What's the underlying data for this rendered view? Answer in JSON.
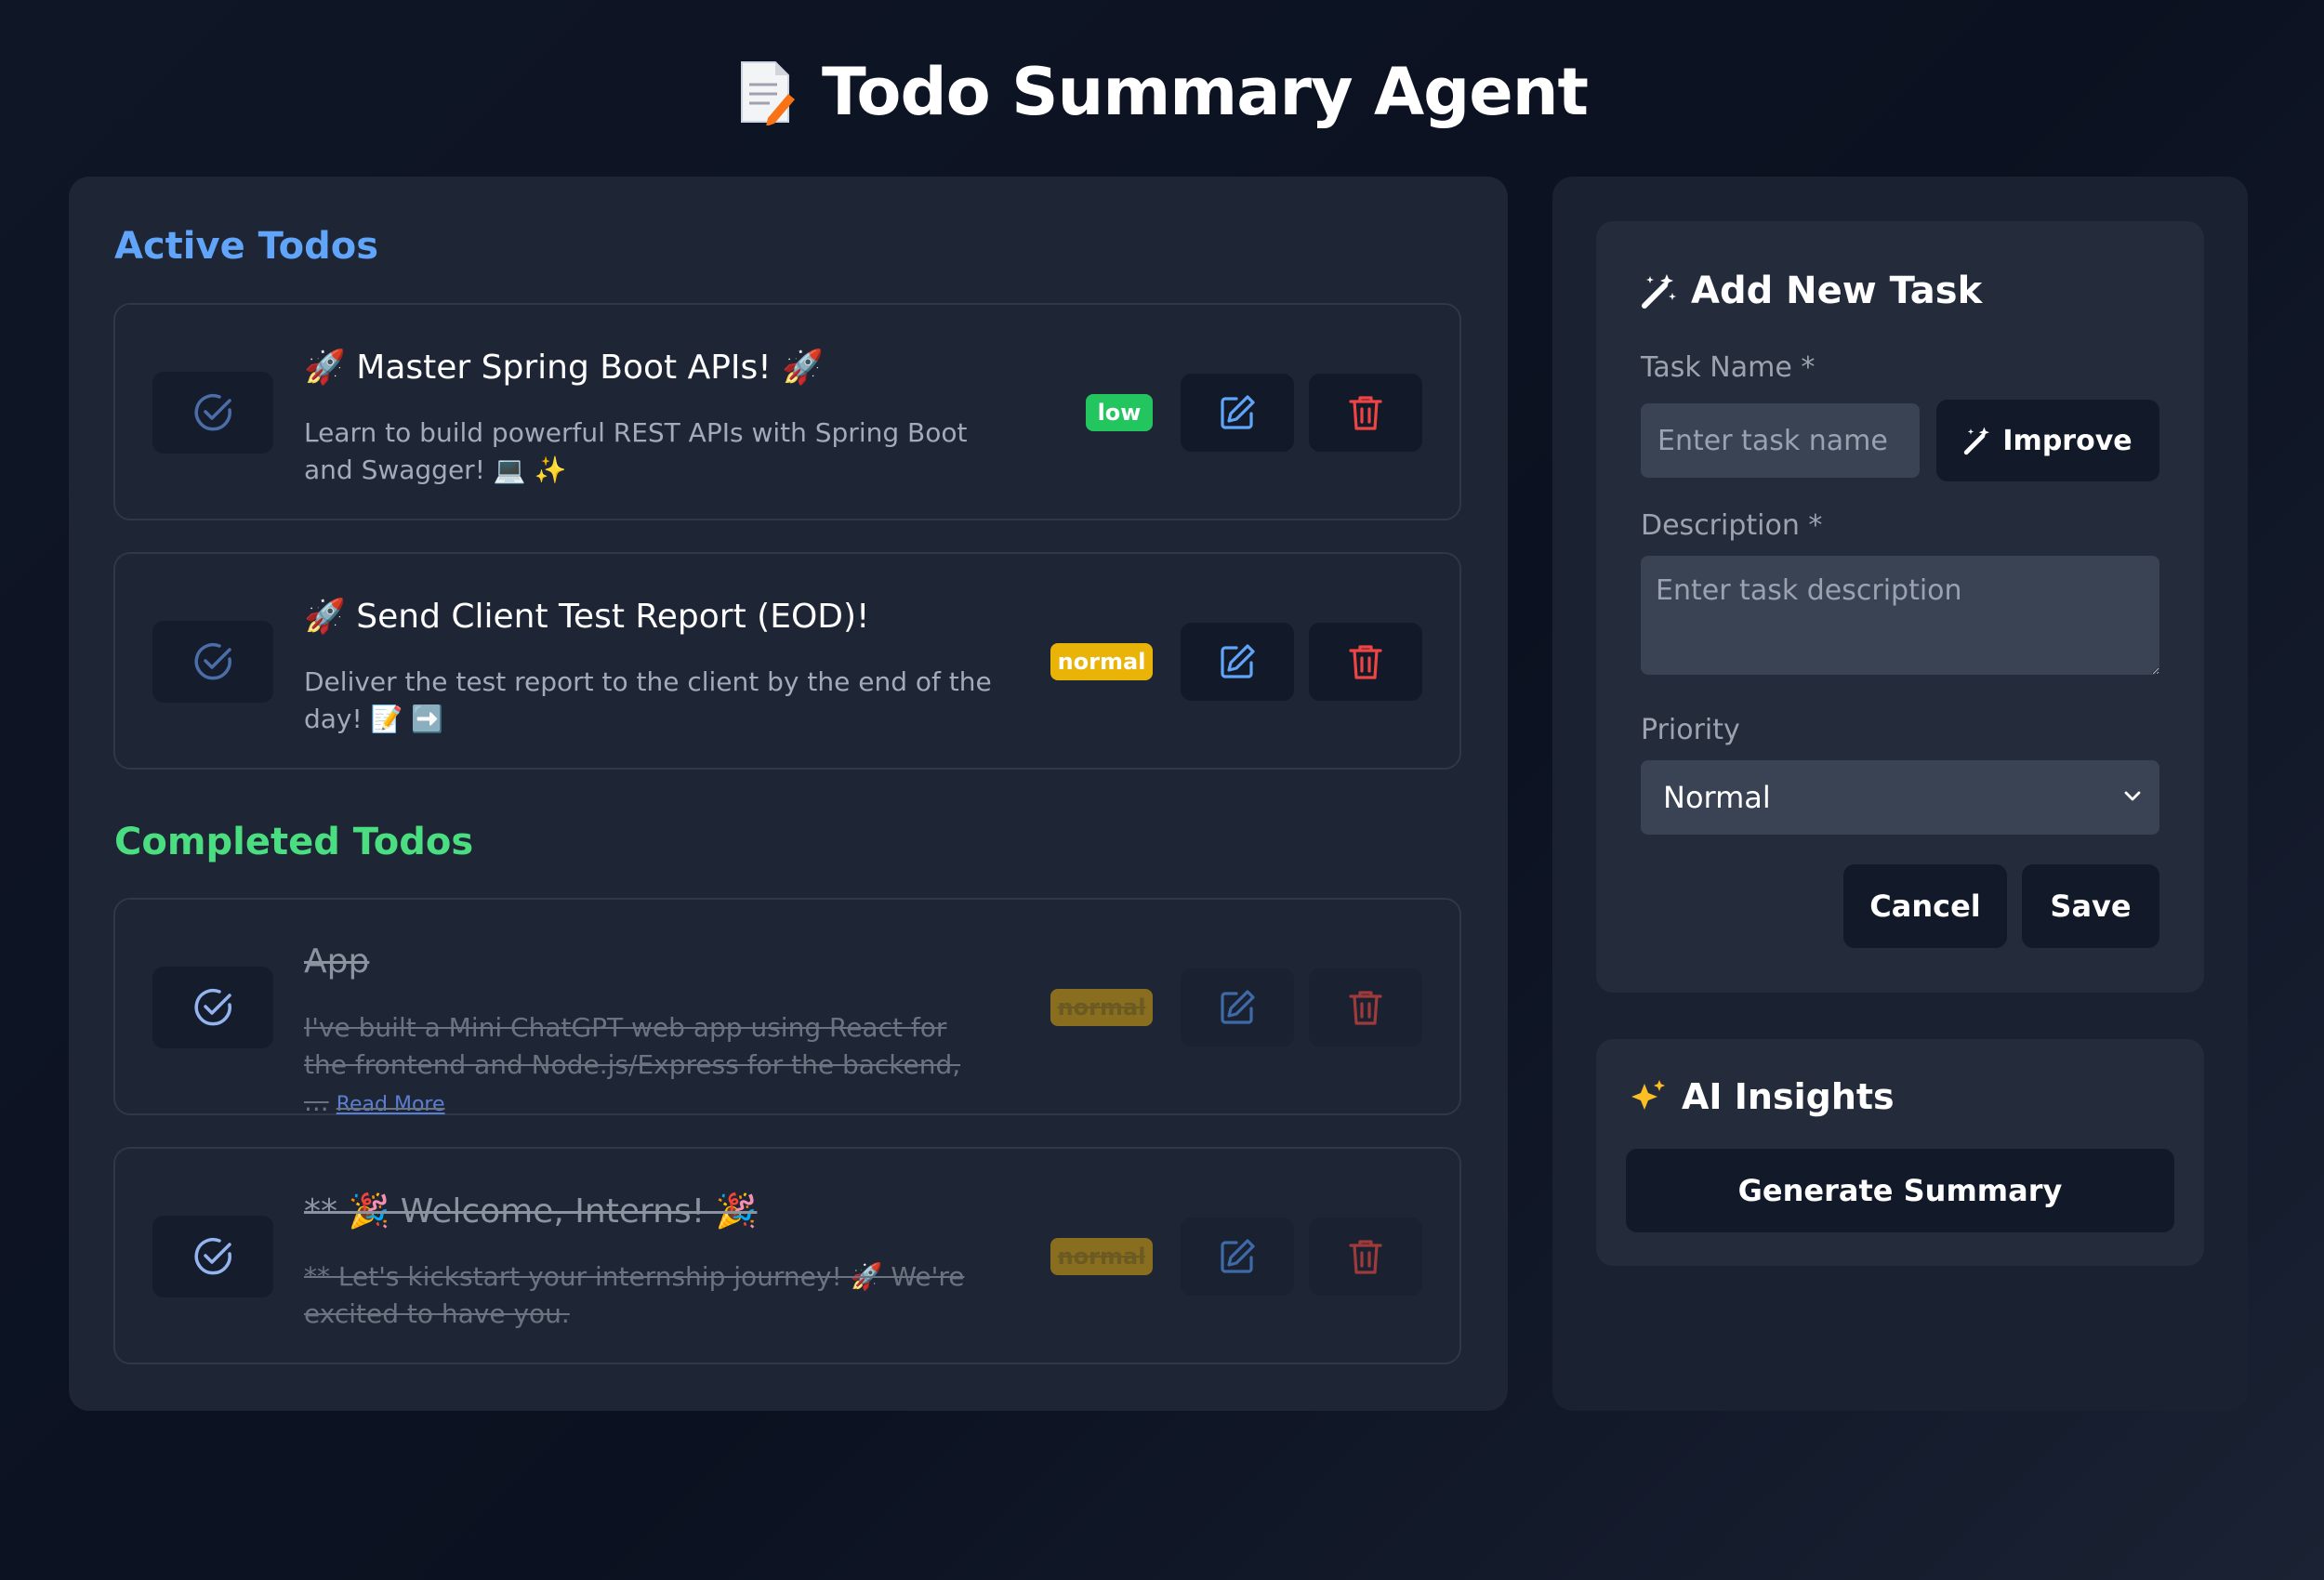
{
  "app": {
    "title": "Todo Summary Agent",
    "title_icon": "document-pencil-icon"
  },
  "active_section": {
    "heading": "Active Todos",
    "todos": [
      {
        "title": "🚀 Master Spring Boot APIs! 🚀",
        "description": "Learn to build powerful REST APIs with Spring Boot and Swagger! 💻 ✨",
        "priority": "low"
      },
      {
        "title": "🚀 Send Client Test Report (EOD)!",
        "description": "Deliver the test report to the client by the end of the day! 📝 ➡️",
        "priority": "normal"
      }
    ]
  },
  "completed_section": {
    "heading": "Completed Todos",
    "todos": [
      {
        "title": "App",
        "description": "I've built a Mini ChatGPT web app using React for the frontend and Node.js/Express for the backend, ...",
        "read_more": "Read More",
        "priority": "normal"
      },
      {
        "title": "** 🎉 Welcome, Interns! 🎉",
        "description": "** Let's kickstart your internship journey! 🚀 We're excited to have you.",
        "priority": "normal"
      }
    ]
  },
  "form": {
    "title": "Add New Task",
    "title_icon": "magic-wand-icon",
    "task_name_label": "Task Name *",
    "task_name_placeholder": "Enter task name",
    "improve_label": "Improve",
    "description_label": "Description *",
    "description_placeholder": "Enter task description",
    "priority_label": "Priority",
    "priority_value": "Normal",
    "cancel_label": "Cancel",
    "save_label": "Save"
  },
  "ai": {
    "title": "AI Insights",
    "title_icon": "sparkles-icon",
    "generate_label": "Generate Summary"
  },
  "colors": {
    "active_heading": "#60a5fa",
    "completed_heading": "#4ade80",
    "badge_low": "#22c55e",
    "badge_normal": "#eab308",
    "edit_icon": "#60a5fa",
    "delete_icon": "#ef4444"
  }
}
